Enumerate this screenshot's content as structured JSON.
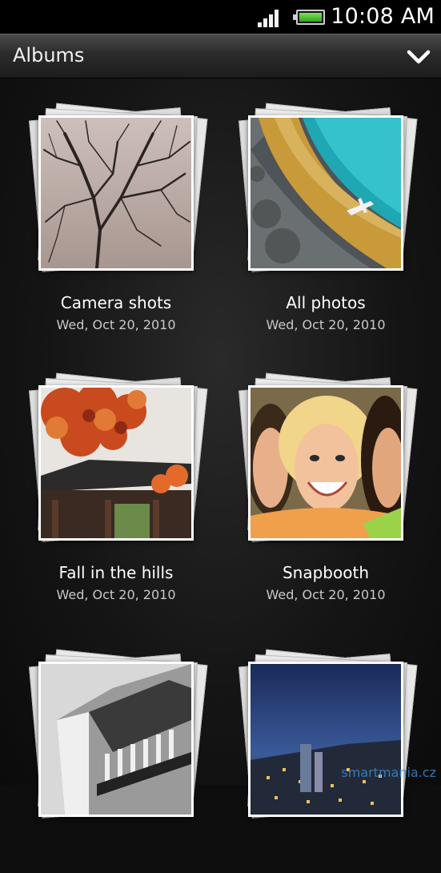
{
  "status_bar": {
    "time": "10:08 AM",
    "signal_icon": "signal-strength-icon",
    "battery_icon": "battery-full-icon"
  },
  "header": {
    "title": "Albums",
    "dropdown_icon": "chevron-down-icon"
  },
  "albums": [
    {
      "name": "Camera shots",
      "date": "Wed, Oct 20, 2010",
      "thumbnail": "bare-tree"
    },
    {
      "name": "All photos",
      "date": "Wed, Oct 20, 2010",
      "thumbnail": "pool-airplane"
    },
    {
      "name": "Fall in the hills",
      "date": "Wed, Oct 20, 2010",
      "thumbnail": "autumn-temple"
    },
    {
      "name": "Snapbooth",
      "date": "Wed, Oct 20, 2010",
      "thumbnail": "smiling-friends"
    },
    {
      "name": "",
      "date": "",
      "thumbnail": "building-balconies"
    },
    {
      "name": "",
      "date": "",
      "thumbnail": "city-night"
    }
  ],
  "watermark": "smartmania.cz"
}
